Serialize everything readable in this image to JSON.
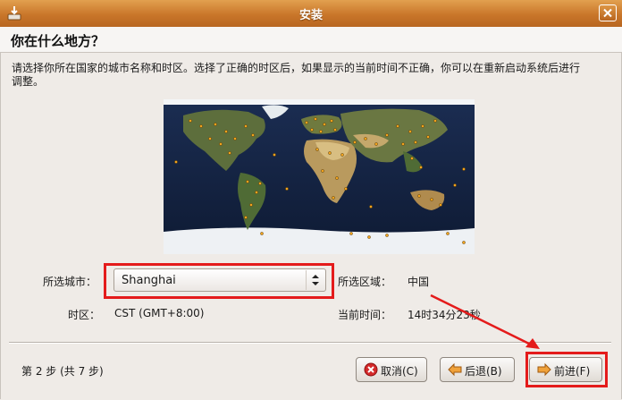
{
  "window": {
    "title": "安装"
  },
  "header": {
    "title": "你在什么地方？"
  },
  "instructions": "请选择你所在国家的城市名称和时区。选择了正确的时区后，如果显示的当前时间不正确，你可以在重新启动系统后进行调整。",
  "form": {
    "city_label": "所选城市：",
    "city_value": "Shanghai",
    "region_label": "所选区域：",
    "region_value": "中国",
    "tz_label": "时区：",
    "tz_value": "CST (GMT+8:00)",
    "time_label": "当前时间：",
    "time_value": "14时34分23秒"
  },
  "footer": {
    "step": "第 2 步 (共 7 步)",
    "cancel_label": "取消(C)",
    "back_label": "后退(B)",
    "forward_label": "前进(F)"
  },
  "icons": {
    "app": "installer-icon",
    "close": "close-icon",
    "cancel": "cancel-icon",
    "back": "back-arrow-icon",
    "forward": "forward-arrow-icon",
    "combo": "spin-arrows-icon"
  },
  "colors": {
    "titlebar": "#c9762a",
    "highlight": "#e41b1b",
    "map_ocean": "#13203a",
    "city_dot": "#f2a21b"
  }
}
